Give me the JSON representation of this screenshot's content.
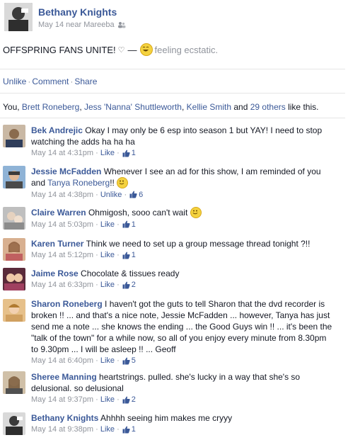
{
  "post": {
    "author": "Bethany Knights",
    "date": "May 14 near Mareeba",
    "audience_icon": "friends-icon",
    "status_text": "OFFSPRING FANS UNITE!",
    "heart_glyph": "♡",
    "dash": "—",
    "feeling_text": "feeling ecstatic."
  },
  "actions": {
    "unlike": "Unlike",
    "sep": "·",
    "comment": "Comment",
    "share": "Share"
  },
  "likes": {
    "prefix": "You, ",
    "name1": "Brett Roneberg",
    "name2": "Jess 'Nanna' Shuttleworth",
    "name3": "Kellie Smith",
    "and_text": " and ",
    "others": "29 others",
    "suffix": " like this."
  },
  "comments": [
    {
      "name": "Bek Andrejic",
      "text": "Okay I may only be 6 esp into season 1 but YAY! I need to stop watching the adds ha ha ha",
      "time": "May 14 at 4:31pm",
      "action": "Like",
      "count": "1"
    },
    {
      "name": "Jessie McFadden",
      "text": "Whenever I see an ad for this show, I am reminded of you and",
      "mention": "Tanya Roneberg",
      "text_after": "!!",
      "time": "May 14 at 4:38pm",
      "action": "Unlike",
      "count": "6"
    },
    {
      "name": "Claire Warren",
      "text": "Ohmigosh, sooo can't wait",
      "time": "May 14 at 5:03pm",
      "action": "Like",
      "count": "1"
    },
    {
      "name": "Karen Turner",
      "text": "Think we need to set up a group message thread tonight ?!!",
      "time": "May 14 at 5:12pm",
      "action": "Like",
      "count": "1"
    },
    {
      "name": "Jaime Rose",
      "text": "Chocolate & tissues ready",
      "time": "May 14 at 6:33pm",
      "action": "Like",
      "count": "2"
    },
    {
      "name": "Sharon Roneberg",
      "text": "I haven't got the guts to tell Sharon that the dvd recorder is broken !! ... and that's a nice note, Jessie McFadden ... however, Tanya has just send me a note ... she knows the ending ... the Good Guys win !! ... it's been the \"talk of the town\" for a while now, so all of you enjoy every minute from 8.30pm to 9.30pm ... I will be asleep !! ... Geoff",
      "time": "May 14 at 6:40pm",
      "action": "Like",
      "count": "5"
    },
    {
      "name": "Sheree Manning",
      "text": "heartstrings. pulled. she's lucky in a way that she's so delusional. so delusional",
      "time": "May 14 at 9:37pm",
      "action": "Like",
      "count": "2"
    },
    {
      "name": "Bethany Knights",
      "text": "Ahhhh seeing him makes me cryyy",
      "time": "May 14 at 9:38pm",
      "action": "Like",
      "count": "1"
    }
  ],
  "meta_sep": "·",
  "colors": {
    "link": "#3b5998",
    "muted": "#90949c",
    "divider": "#e5e5e5"
  }
}
